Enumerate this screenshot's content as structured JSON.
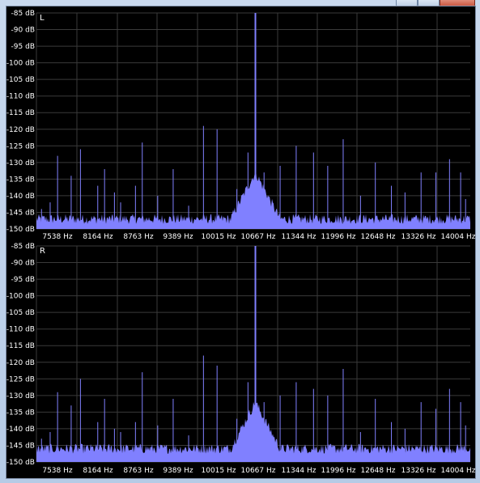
{
  "window": {
    "buttons": [
      "minimize",
      "maximize",
      "close"
    ]
  },
  "colors": {
    "background": "#000000",
    "grid": "#3a3a3a",
    "spectrum": "#8080ff",
    "text": "#ffffff"
  },
  "chart_data": [
    {
      "type": "area",
      "channel_label": "L",
      "ylabels": [
        "-85 dB",
        "-90 dB",
        "-95 dB",
        "-100 dB",
        "-105 dB",
        "-110 dB",
        "-115 dB",
        "-120 dB",
        "-125 dB",
        "-130 dB",
        "-135 dB",
        "-140 dB",
        "-145 dB",
        "-150 dB"
      ],
      "xlabels": [
        "7538 Hz",
        "8164 Hz",
        "8763 Hz",
        "9389 Hz",
        "10015 Hz",
        "10667 Hz",
        "11344 Hz",
        "11996 Hz",
        "12648 Hz",
        "13326 Hz",
        "14004 Hz"
      ],
      "ylim": [
        -150,
        -85
      ],
      "xlim": [
        7538,
        14556
      ],
      "noise_floor": -147,
      "grid": true,
      "peaks": [
        {
          "x": 7620,
          "y": -144
        },
        {
          "x": 7760,
          "y": -142
        },
        {
          "x": 7880,
          "y": -128
        },
        {
          "x": 8100,
          "y": -134
        },
        {
          "x": 8250,
          "y": -126
        },
        {
          "x": 8530,
          "y": -137
        },
        {
          "x": 8640,
          "y": -132
        },
        {
          "x": 8800,
          "y": -139
        },
        {
          "x": 8900,
          "y": -142
        },
        {
          "x": 9140,
          "y": -137
        },
        {
          "x": 9250,
          "y": -124
        },
        {
          "x": 9500,
          "y": -140
        },
        {
          "x": 9750,
          "y": -132
        },
        {
          "x": 10000,
          "y": -143
        },
        {
          "x": 10240,
          "y": -119
        },
        {
          "x": 10460,
          "y": -120
        },
        {
          "x": 10780,
          "y": -138
        },
        {
          "x": 10960,
          "y": -127
        },
        {
          "x": 11080,
          "y": -85
        },
        {
          "x": 11220,
          "y": -133
        },
        {
          "x": 11480,
          "y": -131
        },
        {
          "x": 11740,
          "y": -125
        },
        {
          "x": 12020,
          "y": -127
        },
        {
          "x": 12250,
          "y": -131
        },
        {
          "x": 12500,
          "y": -123
        },
        {
          "x": 12780,
          "y": -140
        },
        {
          "x": 13020,
          "y": -130
        },
        {
          "x": 13280,
          "y": -137
        },
        {
          "x": 13500,
          "y": -139
        },
        {
          "x": 13760,
          "y": -133
        },
        {
          "x": 14000,
          "y": -133
        },
        {
          "x": 14220,
          "y": -129
        },
        {
          "x": 14400,
          "y": -133
        },
        {
          "x": 14480,
          "y": -141
        }
      ]
    },
    {
      "type": "area",
      "channel_label": "R",
      "ylabels": [
        "-85 dB",
        "-90 dB",
        "-95 dB",
        "-100 dB",
        "-105 dB",
        "-110 dB",
        "-115 dB",
        "-120 dB",
        "-125 dB",
        "-130 dB",
        "-135 dB",
        "-140 dB",
        "-145 dB",
        "-150 dB"
      ],
      "xlabels": [
        "7538 Hz",
        "8164 Hz",
        "8763 Hz",
        "9389 Hz",
        "10015 Hz",
        "10667 Hz",
        "11344 Hz",
        "11996 Hz",
        "12648 Hz",
        "13326 Hz",
        "14004 Hz"
      ],
      "ylim": [
        -150,
        -85
      ],
      "xlim": [
        7538,
        14556
      ],
      "noise_floor": -146,
      "grid": true,
      "peaks": [
        {
          "x": 7620,
          "y": -143
        },
        {
          "x": 7760,
          "y": -141
        },
        {
          "x": 7880,
          "y": -129
        },
        {
          "x": 8100,
          "y": -133
        },
        {
          "x": 8250,
          "y": -125
        },
        {
          "x": 8530,
          "y": -138
        },
        {
          "x": 8640,
          "y": -131
        },
        {
          "x": 8800,
          "y": -140
        },
        {
          "x": 8900,
          "y": -141
        },
        {
          "x": 9140,
          "y": -138
        },
        {
          "x": 9250,
          "y": -123
        },
        {
          "x": 9500,
          "y": -139
        },
        {
          "x": 9750,
          "y": -131
        },
        {
          "x": 10000,
          "y": -142
        },
        {
          "x": 10240,
          "y": -118
        },
        {
          "x": 10460,
          "y": -121
        },
        {
          "x": 10780,
          "y": -137
        },
        {
          "x": 10960,
          "y": -126
        },
        {
          "x": 11080,
          "y": -85
        },
        {
          "x": 11220,
          "y": -132
        },
        {
          "x": 11480,
          "y": -130
        },
        {
          "x": 11740,
          "y": -126
        },
        {
          "x": 12020,
          "y": -128
        },
        {
          "x": 12250,
          "y": -130
        },
        {
          "x": 12500,
          "y": -122
        },
        {
          "x": 12780,
          "y": -141
        },
        {
          "x": 13020,
          "y": -131
        },
        {
          "x": 13280,
          "y": -138
        },
        {
          "x": 13500,
          "y": -140
        },
        {
          "x": 13760,
          "y": -132
        },
        {
          "x": 14000,
          "y": -134
        },
        {
          "x": 14220,
          "y": -128
        },
        {
          "x": 14400,
          "y": -132
        },
        {
          "x": 14480,
          "y": -139
        }
      ]
    }
  ]
}
